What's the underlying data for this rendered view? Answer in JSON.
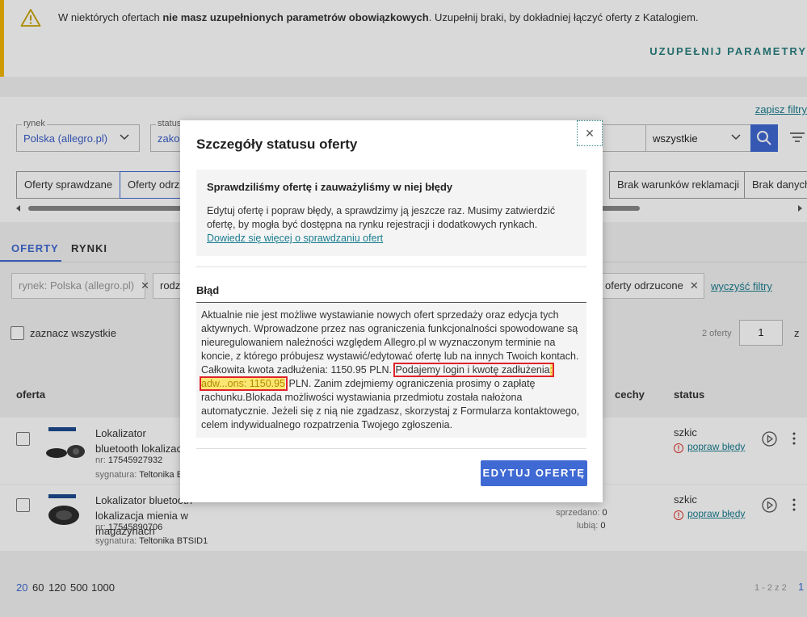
{
  "banner": {
    "text_before": "W niektórych ofertach ",
    "text_bold": "nie masz uzupełnionych parametrów obowiązkowych",
    "text_after": ". Uzupełnij braki, by dokładniej łączyć oferty z Katalogiem.",
    "action": "UZUPEŁNIJ PARAMETRY",
    "warning_color": "#f2b705"
  },
  "filters": {
    "save_link": "zapisz filtry",
    "market_label": "rynek",
    "market_value": "Polska (allegro.pl)",
    "status_label": "status",
    "status_value": "zakoń",
    "third_value": "wszystkie",
    "search_icon": "search-icon",
    "chips": [
      "Oferty sprawdzane",
      "Oferty odrzu",
      "Brak warunków reklamacji",
      "Brak danych"
    ]
  },
  "tabs": [
    "OFERTY",
    "RYNKI"
  ],
  "active_filters": {
    "market_chip": "rynek: Polska (allegro.pl)",
    "second_chip": "rodza",
    "rejected_chip": "oferty odrzucone",
    "clear_link": "wyczyść filtry"
  },
  "list": {
    "select_all": "zaznacz wszystkie",
    "count": "2 oferty",
    "page": "1",
    "page_of": "z",
    "columns": {
      "offer": "oferta",
      "prices": "cechy",
      "status": "status"
    }
  },
  "rows": [
    {
      "name": "Lokalizator bluetooth lokalizacja narzędzi",
      "nr_label": "nr: ",
      "nr": "17545927932",
      "sig_label": "sygnatura: ",
      "sig": "Teltonika BTSI",
      "status": "szkic",
      "fix": "popraw błędy"
    },
    {
      "name": "Lokalizator bluetooth lokalizacja mienia w magazynach",
      "nr_label": "nr: ",
      "nr": "17545890706",
      "sig_label": "sygnatura: ",
      "sig": "Teltonika BTSID1",
      "status": "szkic",
      "fix": "popraw błędy",
      "sold_label": "sprzedano: ",
      "sold": "0",
      "likes_label": "lubią: ",
      "likes": "0"
    }
  ],
  "pagination": {
    "sizes": [
      "20",
      "60",
      "120",
      "500",
      "1000"
    ],
    "range": "1 - 2 z 2",
    "current": "1"
  },
  "modal": {
    "title": "Szczegóły statusu oferty",
    "close_glyph": "×",
    "info_heading": "Sprawdziliśmy ofertę i zauważyliśmy w niej błędy",
    "info_text": "Edytuj ofertę i popraw błędy, a sprawdzimy ją jeszcze raz. Musimy zatwierdzić ofertę, by mogła być dostępna na rynku rejestracji i dodatkowych rynkach. ",
    "info_link": "Dowiedz się więcej o sprawdzaniu ofert",
    "error_title": "Błąd",
    "error_text_1": "Aktualnie nie jest możliwe wystawianie nowych ofert sprzedaży oraz edycja tych aktywnych. Wprowadzone przez nas ograniczenia funkcjonalności spowodowane są nieuregulowaniem należności względem Allegro.pl w wyznaczonym terminie na koncie, z którego próbujesz wystawić/edytować ofertę lub na innych Twoich kontach. Całkowita kwota zadłużenia: 1150.95 PLN. ",
    "error_highlight_plain": "Podajemy login i kwotę zadłużenia",
    "error_highlight_marked": ": adw...ons: 1150.95",
    "error_text_2": " PLN. Zanim zdejmiemy ograniczenia prosimy o zapłatę rachunku.Blokada możliwości wystawiania przedmiotu została nałożona automatycznie. Jeżeli się z nią nie zgadzasz, skorzystaj z Formularza kontaktowego, celem indywidualnego rozpatrzenia Twojego zgłoszenia.",
    "edit_button": "EDYTUJ OFERTĘ",
    "accent": "#3f69d3",
    "highlight_color": "#fbe672",
    "marker_color": "#e0232a"
  }
}
